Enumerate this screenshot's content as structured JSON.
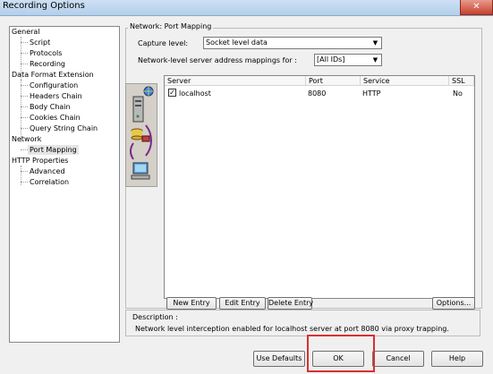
{
  "window": {
    "title": "Recording Options",
    "close_glyph": "✕"
  },
  "tree": {
    "items": [
      {
        "label": "General"
      },
      {
        "label": "Script"
      },
      {
        "label": "Protocols"
      },
      {
        "label": "Recording"
      },
      {
        "label": "Data Format Extension"
      },
      {
        "label": "Configuration"
      },
      {
        "label": "Headers Chain"
      },
      {
        "label": "Body Chain"
      },
      {
        "label": "Cookies Chain"
      },
      {
        "label": "Query String Chain"
      },
      {
        "label": "Network"
      },
      {
        "label": "Port Mapping",
        "selected": true
      },
      {
        "label": "HTTP Properties"
      },
      {
        "label": "Advanced"
      },
      {
        "label": "Correlation"
      }
    ]
  },
  "port_mapping": {
    "group_title": "Network: Port Mapping",
    "capture_level_label": "Capture level:",
    "capture_level_value": "Socket level data",
    "mappings_label": "Network-level server address mappings for :",
    "mappings_value": "[All IDs]",
    "columns": [
      "Server",
      "Port",
      "Service",
      "SSL"
    ],
    "rows": [
      {
        "checked": true,
        "server": "localhost",
        "port": "8080",
        "service": "HTTP",
        "ssl": "No"
      }
    ],
    "buttons": {
      "new_entry": "New Entry",
      "edit_entry": "Edit Entry",
      "delete_entry": "Delete Entry",
      "options": "Options..."
    },
    "icons": [
      "network-server-icon",
      "database-icon",
      "workstation-icon"
    ]
  },
  "description": {
    "title": "Description :",
    "text": "Network level interception enabled for localhost server at port 8080 via proxy trapping."
  },
  "dialog_buttons": {
    "use_defaults": "Use Defaults",
    "ok": "OK",
    "cancel": "Cancel",
    "help": "Help"
  },
  "colors": {
    "highlight": "#d93030",
    "title_bar": "#b4cfea",
    "close_button": "#c6402e"
  }
}
